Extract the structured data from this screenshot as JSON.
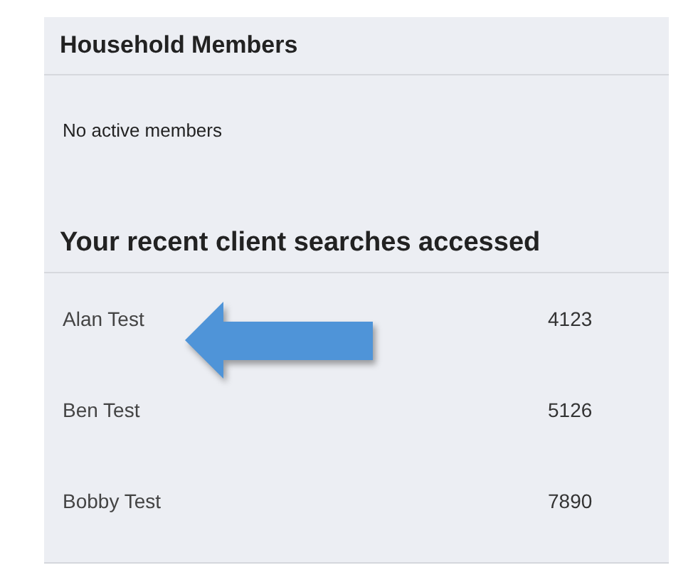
{
  "household": {
    "title": "Household Members",
    "message": "No active members"
  },
  "recent": {
    "title": "Your recent client searches accessed",
    "rows": [
      {
        "name": "Alan Test",
        "number": "4123",
        "highlighted": true
      },
      {
        "name": "Ben Test",
        "number": "5126",
        "highlighted": false
      },
      {
        "name": "Bobby Test",
        "number": "7890",
        "highlighted": false
      }
    ]
  }
}
